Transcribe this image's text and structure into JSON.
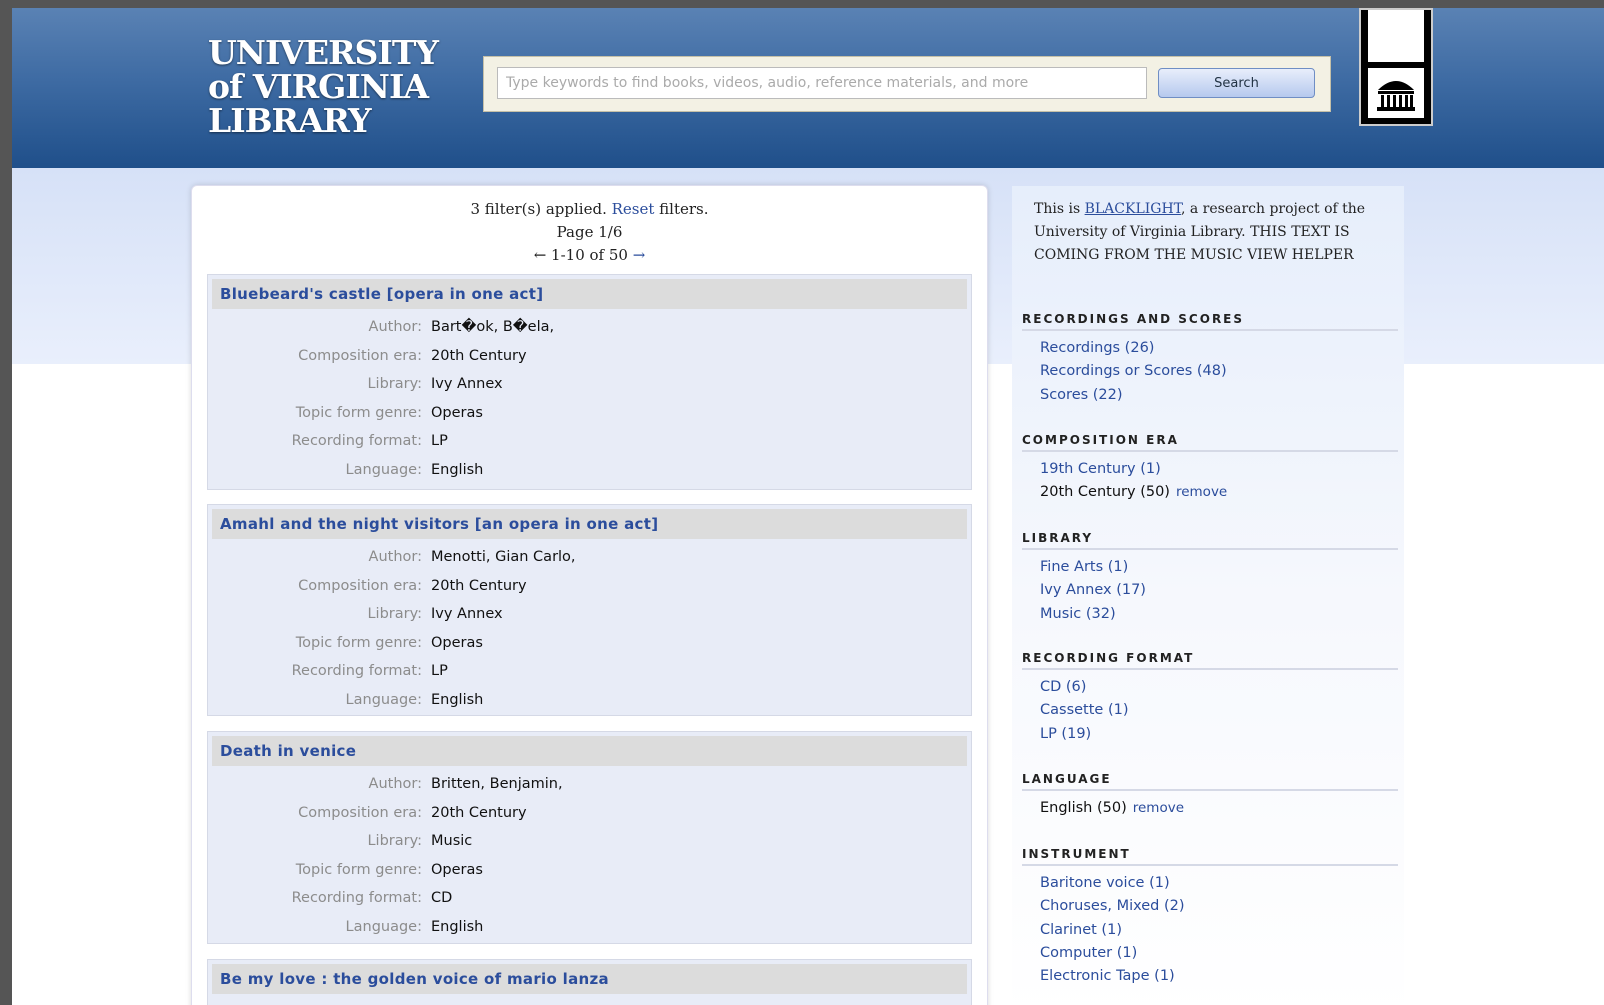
{
  "logo": {
    "line1": "UNIVERSITY",
    "line2": "of VIRGINIA",
    "line3": "LIBRARY"
  },
  "search": {
    "placeholder": "Type keywords to find books, videos, audio, reference materials, and more",
    "button_label": "Search"
  },
  "summary": {
    "filters_text": "3 filter(s) applied. ",
    "reset_label": "Reset",
    "filters_suffix": " filters.",
    "page_text": "Page 1/6",
    "prev_arrow": "←",
    "range_text": "1-10 of 50",
    "next_arrow": "→"
  },
  "records": [
    {
      "title": "Bluebeard's castle [opera in one act]",
      "fields": [
        {
          "label": "Author:",
          "value": "Bart�ok, B�ela,"
        },
        {
          "label": "Composition era:",
          "value": "20th Century"
        },
        {
          "label": "Library:",
          "value": "Ivy Annex"
        },
        {
          "label": "Topic form genre:",
          "value": "Operas"
        },
        {
          "label": "Recording format:",
          "value": "LP"
        },
        {
          "label": "Language:",
          "value": "English"
        }
      ]
    },
    {
      "title": "Amahl and the night visitors [an opera in one act]",
      "fields": [
        {
          "label": "Author:",
          "value": "Menotti, Gian Carlo,"
        },
        {
          "label": "Composition era:",
          "value": "20th Century"
        },
        {
          "label": "Library:",
          "value": "Ivy Annex"
        },
        {
          "label": "Topic form genre:",
          "value": "Operas"
        },
        {
          "label": "Recording format:",
          "value": "LP"
        },
        {
          "label": "Language:",
          "value": "English"
        }
      ]
    },
    {
      "title": "Death in venice",
      "fields": [
        {
          "label": "Author:",
          "value": "Britten, Benjamin,"
        },
        {
          "label": "Composition era:",
          "value": "20th Century"
        },
        {
          "label": "Library:",
          "value": "Music"
        },
        {
          "label": "Topic form genre:",
          "value": "Operas"
        },
        {
          "label": "Recording format:",
          "value": "CD"
        },
        {
          "label": "Language:",
          "value": "English"
        }
      ]
    },
    {
      "title": "Be my love : the golden voice of mario lanza",
      "fields": []
    }
  ],
  "sidebar": {
    "blurb_pre": "This is ",
    "blurb_link": "BLACKLIGHT",
    "blurb_post": ", a research project of the University of Virginia Library. THIS TEXT IS COMING FROM THE MUSIC VIEW HELPER",
    "facets": [
      {
        "heading": "RECORDINGS AND SCORES",
        "items": [
          {
            "label": "Recordings (26)"
          },
          {
            "label": "Recordings or Scores (48)"
          },
          {
            "label": "Scores (22)"
          }
        ]
      },
      {
        "heading": "COMPOSITION ERA",
        "items": [
          {
            "label": "19th Century (1)"
          },
          {
            "label": "20th Century (50)",
            "selected": true,
            "remove": "remove"
          }
        ]
      },
      {
        "heading": "LIBRARY",
        "items": [
          {
            "label": "Fine Arts (1)"
          },
          {
            "label": "Ivy Annex (17)"
          },
          {
            "label": "Music (32)"
          }
        ]
      },
      {
        "heading": "RECORDING FORMAT",
        "items": [
          {
            "label": "CD (6)"
          },
          {
            "label": "Cassette (1)"
          },
          {
            "label": "LP (19)"
          }
        ]
      },
      {
        "heading": "LANGUAGE",
        "items": [
          {
            "label": "English (50)",
            "selected": true,
            "remove": "remove"
          }
        ]
      },
      {
        "heading": "INSTRUMENT",
        "items": [
          {
            "label": "Baritone voice (1)"
          },
          {
            "label": "Choruses, Mixed (2)"
          },
          {
            "label": "Clarinet (1)"
          },
          {
            "label": "Computer (1)"
          },
          {
            "label": "Electronic Tape (1)"
          }
        ]
      }
    ]
  }
}
